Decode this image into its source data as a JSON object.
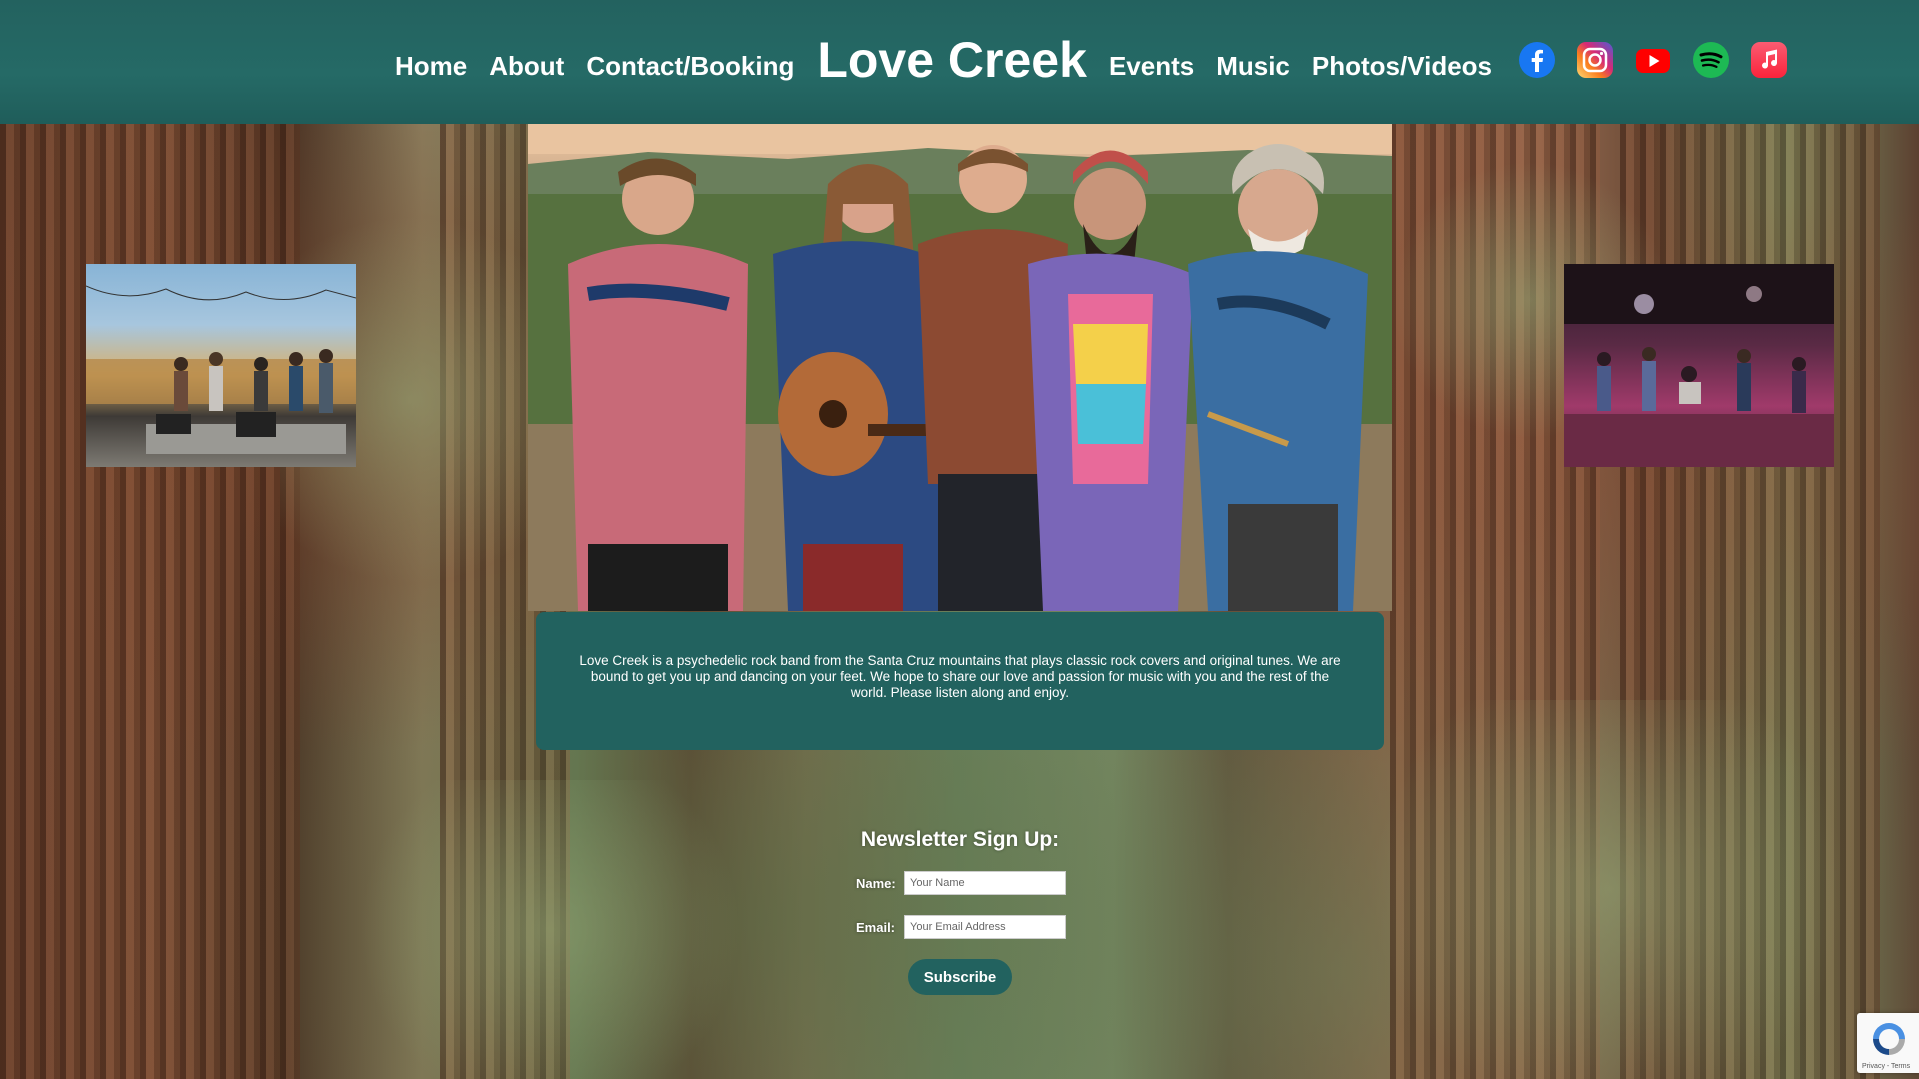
{
  "header": {
    "nav_left": [
      "Home",
      "About",
      "Contact/Booking"
    ],
    "brand": "Love Creek",
    "nav_right": [
      "Events",
      "Music",
      "Photos/Videos"
    ],
    "social": [
      {
        "icon": "facebook-icon",
        "color": "#1877f2"
      },
      {
        "icon": "instagram-icon",
        "color": "#d62976"
      },
      {
        "icon": "youtube-icon",
        "color": "#ff0000"
      },
      {
        "icon": "spotify-icon",
        "color": "#1db954"
      },
      {
        "icon": "apple-music-icon",
        "color": "#fa2d48"
      }
    ]
  },
  "colors": {
    "header_bg": "#23625f",
    "box_bg": "#22625f",
    "text": "#ffffff"
  },
  "about": {
    "text": "Love Creek is a psychedelic rock band from the Santa Cruz mountains that plays classic rock covers and original tunes. We are bound to get you up and dancing on your feet. We hope to share our love and passion for music with you and the rest of the world. Please listen along and enjoy."
  },
  "newsletter": {
    "title": "Newsletter Sign Up:",
    "name_label": "Name:",
    "name_placeholder": "Your Name",
    "email_label": "Email:",
    "email_placeholder": "Your Email Address",
    "button": "Subscribe"
  },
  "recaptcha": {
    "footer": "Privacy - Terms"
  }
}
